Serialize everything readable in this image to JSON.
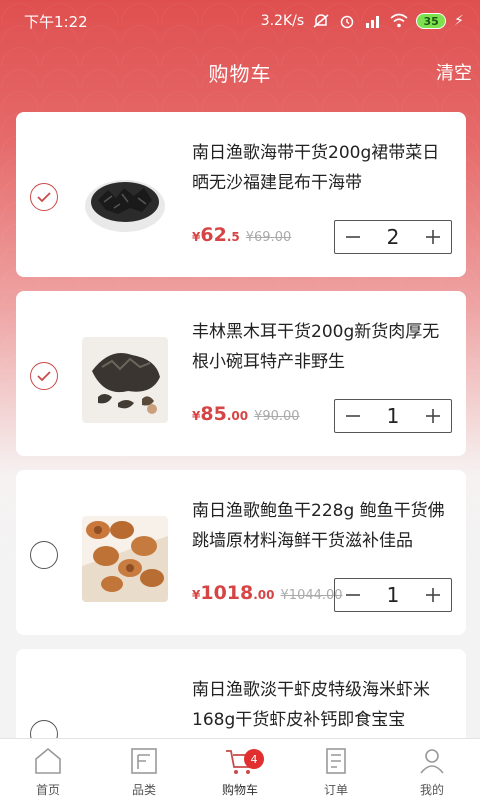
{
  "status_bar": {
    "time": "下午1:22",
    "speed": "3.2K/s",
    "battery": "35"
  },
  "header": {
    "title": "购物车",
    "clear_label": "清空"
  },
  "currency": "¥",
  "items": [
    {
      "title": "南日渔歌海带干货200g裙带菜日晒无沙福建昆布干海带",
      "price_int": "62",
      "price_dec": ".5",
      "old_price": "69.00",
      "qty": "2",
      "checked": true,
      "image": "dried-kelp"
    },
    {
      "title": "丰林黑木耳干货200g新货肉厚无根小碗耳特产非野生",
      "price_int": "85",
      "price_dec": ".00",
      "old_price": "90.00",
      "qty": "1",
      "checked": true,
      "image": "black-fungus"
    },
    {
      "title": "南日渔歌鲍鱼干228g 鲍鱼干货佛跳墙原材料海鲜干货滋补佳品",
      "price_int": "1018",
      "price_dec": ".00",
      "old_price": "1044.00",
      "qty": "1",
      "checked": false,
      "image": "dried-abalone"
    },
    {
      "title": "南日渔歌淡干虾皮特级海米虾米168g干货虾皮补钙即食宝宝",
      "checked": false,
      "image": "dried-shrimp"
    }
  ],
  "tabbar": {
    "tabs": [
      {
        "label": "首页",
        "icon": "home-icon"
      },
      {
        "label": "品类",
        "icon": "category-icon"
      },
      {
        "label": "购物车",
        "icon": "cart-icon",
        "badge": "4"
      },
      {
        "label": "订单",
        "icon": "order-icon"
      },
      {
        "label": "我的",
        "icon": "profile-icon"
      }
    ]
  },
  "colors": {
    "accent": "#d64545",
    "header_bg": "#df4f4f",
    "badge": "#e12e2e"
  }
}
